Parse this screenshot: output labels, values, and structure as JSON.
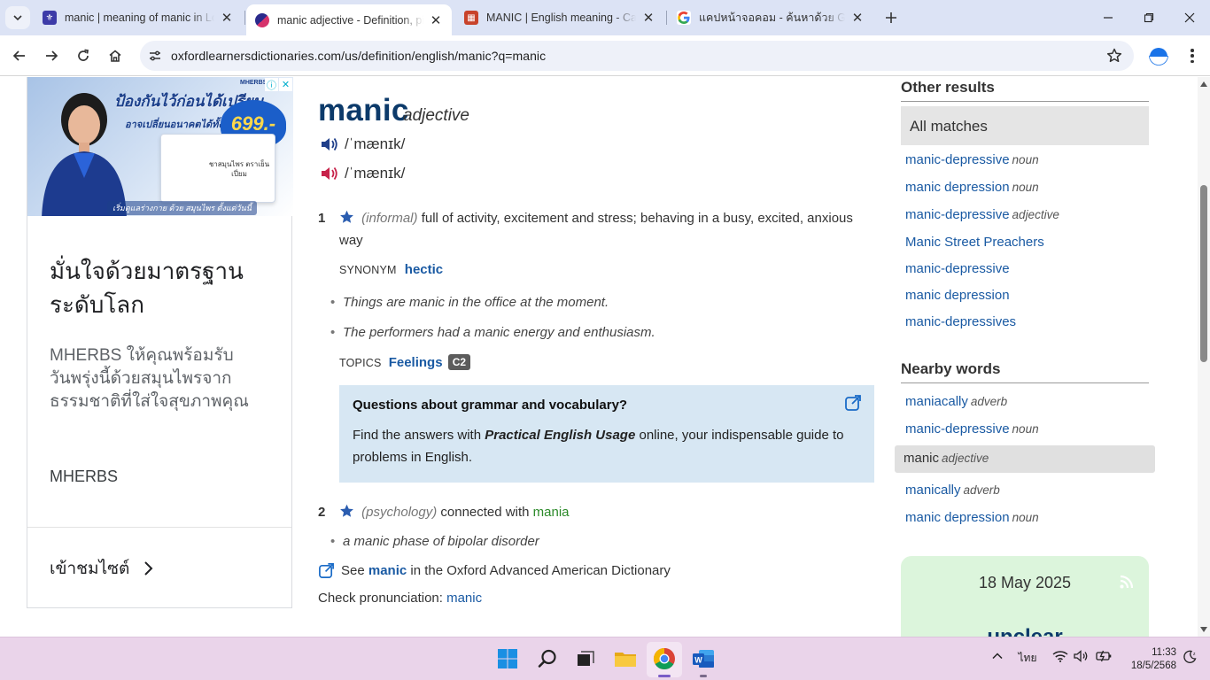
{
  "browser": {
    "tabs": [
      {
        "title": "manic | meaning of manic in Lo",
        "favicon": "longman-icon",
        "color": "#3d3ba8"
      },
      {
        "title": "manic adjective - Definition, pic",
        "favicon": "oxford-icon",
        "color": "#2a2a8c",
        "active": true
      },
      {
        "title": "MANIC | English meaning - Cam",
        "favicon": "cambridge-icon",
        "color": "#c8432b"
      },
      {
        "title": "แคปหน้าจอคอม - ค้นหาด้วย Google",
        "favicon": "google-icon",
        "color": "#4285f4"
      }
    ],
    "url": "oxfordlearnersdictionaries.com/us/definition/english/manic?q=manic"
  },
  "ad": {
    "banner_headline": "ป้องกันไว้ก่อนได้เปรียบ",
    "banner_sub": "อาจเปลี่ยนอนาคตได้ทั้งชีวิต",
    "banner_price": "699.-",
    "banner_pack": "ชาสมุนไพร ตราเย็นเปี่ยม",
    "banner_bottom": "เริ่มดูแลร่างกาย ด้วย สมุนไพร ตั้งแต่วันนี้",
    "banner_mark": "MHERBS",
    "title": "มั่นใจด้วยมาตรฐานระดับโลก",
    "description": "MHERBS ให้คุณพร้อมรับวันพรุ่งนี้ด้วยสมุนไพรจากธรรมชาติที่ใส่ใจสุขภาพคุณ",
    "brand": "MHERBS",
    "visit": "เข้าชมไซต์"
  },
  "entry": {
    "headword": "manic",
    "pos": "adjective",
    "pron_br": "/ˈmænɪk/",
    "pron_us": "/ˈmænɪk/",
    "senses": [
      {
        "num": "1",
        "label": "(informal)",
        "def": "full of activity, excitement and stress; behaving in a busy, excited, anxious way",
        "synonym_label": "SYNONYM",
        "synonym": "hectic",
        "examples": [
          "Things are manic in the office at the moment.",
          "The performers had a manic energy and enthusiasm."
        ],
        "topics_label": "TOPICS",
        "topic": "Feelings",
        "level": "C2"
      },
      {
        "num": "2",
        "label": "(psychology)",
        "def": "connected with",
        "def_link": "mania",
        "examples": [
          "a manic phase of bipolar disorder"
        ]
      }
    ],
    "grammar_box": {
      "title": "Questions about grammar and vocabulary?",
      "text_before": "Find the answers with ",
      "text_em": "Practical English Usage",
      "text_after": " online, your indispensable guide to problems in English."
    },
    "see_also_prefix": "See ",
    "see_also_link": "manic",
    "see_also_suffix": " in the Oxford Advanced American Dictionary",
    "check_pron_label": "Check pronunciation: ",
    "check_pron_link": "manic"
  },
  "right": {
    "other_results": "Other results",
    "all_matches": "All matches",
    "matches": [
      {
        "word": "manic-depressive",
        "pos": "noun"
      },
      {
        "word": "manic depression",
        "pos": "noun"
      },
      {
        "word": "manic-depressive",
        "pos": "adjective"
      },
      {
        "word": "Manic Street Preachers",
        "pos": ""
      },
      {
        "word": "manic-depressive",
        "pos": ""
      },
      {
        "word": "manic depression",
        "pos": ""
      },
      {
        "word": "manic-depressives",
        "pos": ""
      }
    ],
    "nearby_words": "Nearby words",
    "nearby": [
      {
        "word": "maniacally",
        "pos": "adverb"
      },
      {
        "word": "manic-depressive",
        "pos": "noun"
      },
      {
        "word": "manic",
        "pos": "adjective",
        "current": true
      },
      {
        "word": "manically",
        "pos": "adverb"
      },
      {
        "word": "manic depression",
        "pos": "noun"
      }
    ],
    "wotd_date": "18 May 2025",
    "wotd_word": "unclear"
  },
  "taskbar": {
    "language": "ไทย",
    "time": "11:33",
    "date": "18/5/2568"
  }
}
